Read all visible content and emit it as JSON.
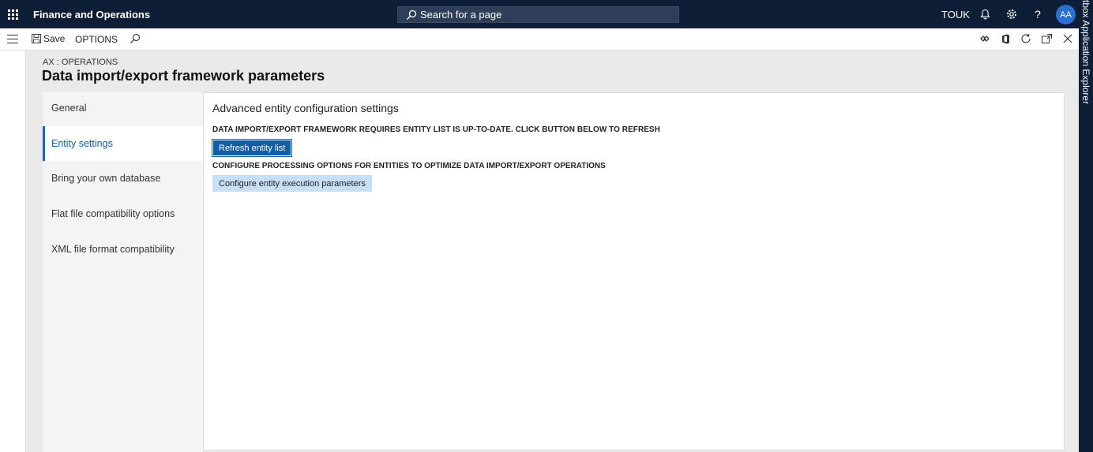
{
  "header": {
    "app_title": "Finance and Operations",
    "search_placeholder": "Search for a page",
    "company": "TOUK",
    "user_initials": "AA",
    "icons": [
      "waffle-icon",
      "bell-icon",
      "gear-icon",
      "help-icon"
    ]
  },
  "side_panel": {
    "label": "tbox  Application Explorer"
  },
  "actionbar": {
    "save_label": "Save",
    "options_label": "OPTIONS",
    "icons": [
      "hamburger-icon",
      "save-icon",
      "search-icon",
      "connector-icon",
      "office-icon",
      "refresh-icon",
      "popout-icon",
      "close-icon"
    ]
  },
  "page": {
    "breadcrumb": "AX : OPERATIONS",
    "title": "Data import/export framework parameters"
  },
  "nav": {
    "items": [
      {
        "label": "General"
      },
      {
        "label": "Entity settings"
      },
      {
        "label": "Bring your own database"
      },
      {
        "label": "Flat file compatibility options"
      },
      {
        "label": "XML file format compatibility"
      }
    ],
    "selected": "Entity settings"
  },
  "content": {
    "section_title": "Advanced entity configuration settings",
    "refresh_label": "DATA IMPORT/EXPORT FRAMEWORK REQUIRES ENTITY LIST IS UP-TO-DATE. CLICK BUTTON BELOW TO REFRESH",
    "refresh_button": "Refresh entity list",
    "configure_label": "CONFIGURE PROCESSING OPTIONS FOR ENTITIES TO OPTIMIZE DATA IMPORT/EXPORT OPERATIONS",
    "configure_button": "Configure entity execution parameters"
  },
  "colors": {
    "topbar": "#0e1e37",
    "accent": "#0f5ea8",
    "secondary_button": "#c7dff5",
    "avatar": "#2b6fd1"
  }
}
